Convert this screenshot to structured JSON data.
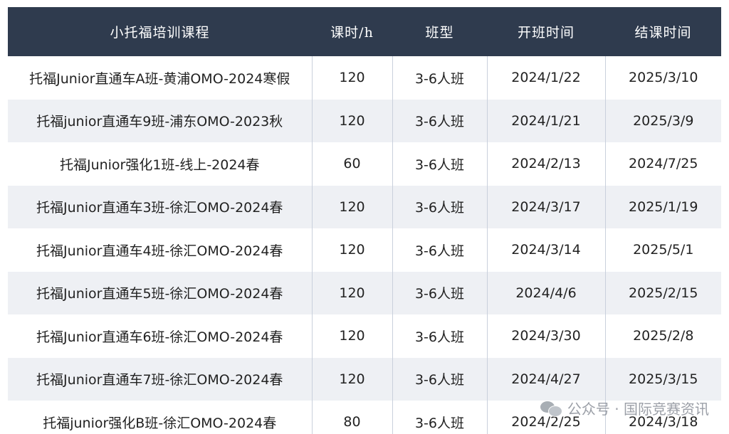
{
  "table": {
    "headers": [
      "小托福培训课程",
      "课时/h",
      "班型",
      "开班时间",
      "结课时间"
    ],
    "rows": [
      [
        "托福Junior直通车A班-黄浦OMO-2024寒假",
        "120",
        "3-6人班",
        "2024/1/22",
        "2025/3/10"
      ],
      [
        "托福junior直通车9班-浦东OMO-2023秋",
        "120",
        "3-6人班",
        "2024/1/21",
        "2025/3/9"
      ],
      [
        "托福Junior强化1班-线上-2024春",
        "60",
        "3-6人班",
        "2024/2/13",
        "2024/7/25"
      ],
      [
        "托福Junior直通车3班-徐汇OMO-2024春",
        "120",
        "3-6人班",
        "2024/3/17",
        "2025/1/19"
      ],
      [
        "托福Junior直通车4班-徐汇OMO-2024春",
        "120",
        "3-6人班",
        "2024/3/14",
        "2025/5/1"
      ],
      [
        "托福Junior直通车5班-徐汇OMO-2024春",
        "120",
        "3-6人班",
        "2024/4/6",
        "2025/2/15"
      ],
      [
        "托福Junior直通车6班-徐汇OMO-2024春",
        "120",
        "3-6人班",
        "2024/3/30",
        "2025/2/8"
      ],
      [
        "托福Junior直通车7班-徐汇OMO-2024春",
        "120",
        "3-6人班",
        "2024/4/27",
        "2025/3/15"
      ],
      [
        "托福junior强化B班-徐汇OMO-2024春",
        "80",
        "3-6人班",
        "2024/2/25",
        "2024/3/18"
      ]
    ]
  },
  "watermark": {
    "text": "公众号 · 国际竞赛资讯",
    "icon": "wechat-icon"
  },
  "colors": {
    "header_bg": "#2f3b4e",
    "header_text": "#ffffff",
    "row_alt_bg": "#eef0f4",
    "border": "#c9d0dc"
  }
}
